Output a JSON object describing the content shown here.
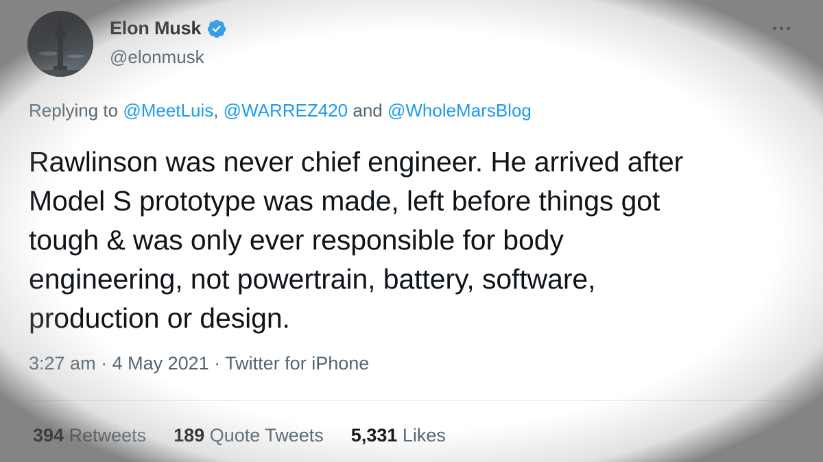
{
  "author": {
    "display_name": "Elon Musk",
    "handle": "@elonmusk"
  },
  "reply": {
    "prefix": "Replying to ",
    "mention_1": "@MeetLuis",
    "separator_1": ", ",
    "mention_2": "@WARREZ420",
    "separator_2": " and ",
    "mention_3": "@WholeMarsBlog"
  },
  "tweet": {
    "text": "Rawlinson was never chief engineer. He arrived after\nModel S prototype was made, left before things got\ntough & was only ever responsible for body\nengineering, not powertrain, battery, software,\nproduction or design."
  },
  "meta": {
    "time": "3:27 am",
    "separator_1": " · ",
    "date": "4 May 2021",
    "separator_2": " · ",
    "source": "Twitter for iPhone"
  },
  "stats": {
    "retweets_count": "394",
    "retweets_label": " Retweets",
    "quotes_count": "189",
    "quotes_label": " Quote Tweets",
    "likes_count": "5,331",
    "likes_label": " Likes"
  },
  "icons": {
    "verified": "verified-badge-icon",
    "more": "more-options-icon"
  },
  "colors": {
    "accent": "#1d9bf0",
    "text": "#0f1419",
    "secondary": "#536471"
  }
}
